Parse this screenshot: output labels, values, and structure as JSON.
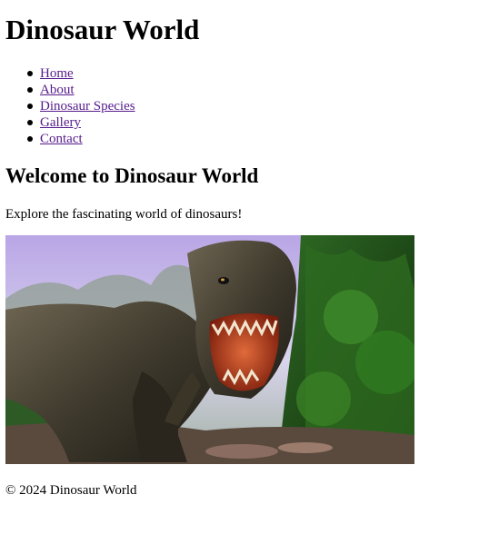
{
  "header": {
    "title": "Dinosaur World"
  },
  "nav": {
    "items": [
      {
        "label": "Home"
      },
      {
        "label": "About"
      },
      {
        "label": "Dinosaur Species"
      },
      {
        "label": "Gallery"
      },
      {
        "label": "Contact"
      }
    ]
  },
  "main": {
    "heading": "Welcome to Dinosaur World",
    "intro": "Explore the fascinating world of dinosaurs!"
  },
  "hero_image": {
    "subject": "t-rex-roaring-in-jungle"
  },
  "footer": {
    "text": "© 2024 Dinosaur World"
  },
  "colors": {
    "link": "#551a8b",
    "text": "#000000",
    "background": "#ffffff"
  }
}
